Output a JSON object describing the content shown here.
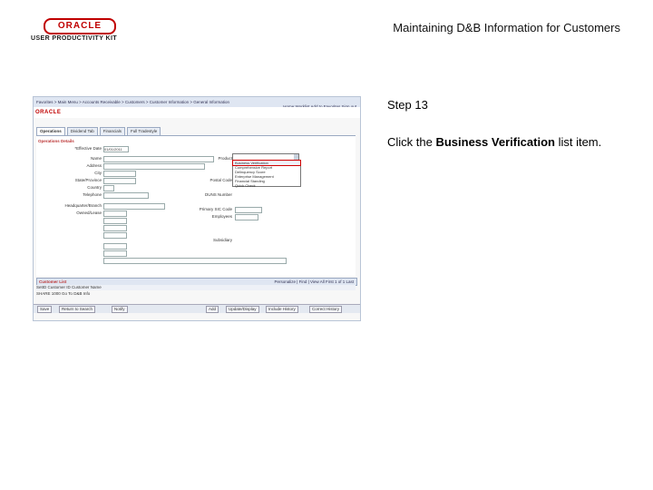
{
  "header": {
    "logo_text": "ORACLE",
    "logo_subtext": "USER PRODUCTIVITY KIT",
    "doc_title": "Maintaining D&B Information for Customers"
  },
  "step": {
    "label": "Step 13",
    "instruction_prefix": "Click the ",
    "instruction_target": "Business Verification",
    "instruction_suffix": " list item."
  },
  "app": {
    "breadcrumb": "Favorites  >  Main Menu  >  Accounts Receivable  >  Customers  >  Customer Information  >  General Information",
    "nav_links": "Home    Worklist    Add to Favorites    Sign out",
    "brand": "ORACLE",
    "tabs": [
      "Operations",
      "Dividend Tab",
      "Financials",
      "Full Tradestyle"
    ],
    "fields": {
      "effective_date_label": "*Effective Date",
      "effective_date_value": "01/01/2011",
      "name_label": "Name",
      "address_label": "Address",
      "city_label": "City",
      "state_label": "State/Province",
      "country_label": "Country",
      "telephone_label": "Telephone",
      "headquarter_label": "Headquarter/Branch",
      "owned_label": "Owned/Lease",
      "product_label": "Product",
      "postal_label": "Postal Code",
      "duns_label": "DUNS Number",
      "primary_sic_label": "Primary SIC Code",
      "employees_label": "Employees",
      "subsidiary_label": "Subsidiary"
    },
    "product_options": [
      "Business Verification",
      "Comprehensive Report",
      "Delinquency Score",
      "Enterprise Management",
      "Financial Standing",
      "Quick Check"
    ],
    "section_operations": "Operations Details",
    "grid_title": "Customer List",
    "grid_right": "Personalize | Find | View All    First  1 of 1  Last",
    "grid_cols": "SetID      Customer ID            Customer Name",
    "grid_row": "SHARE      1000             Go To D&B Info",
    "buttons": [
      "Save",
      "Return to Search",
      "Notify",
      "Add",
      "Update/Display",
      "Include History",
      "Correct History"
    ]
  }
}
